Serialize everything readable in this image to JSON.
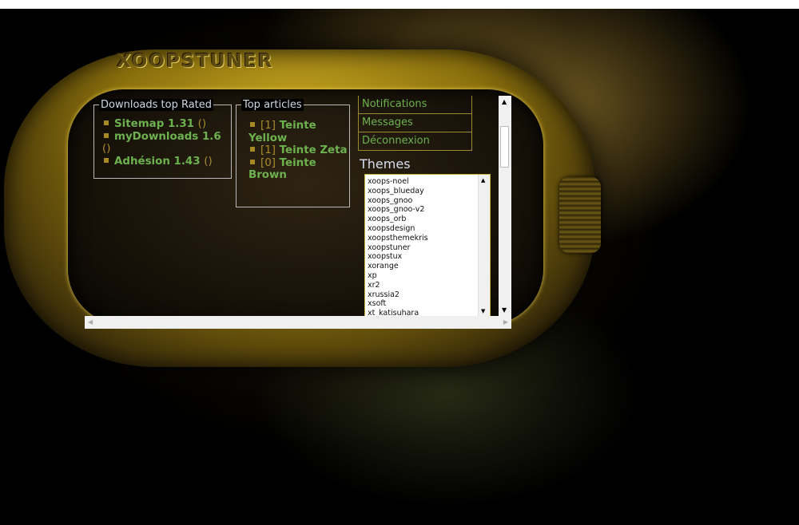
{
  "site": {
    "logo": "XOOPSTUNER"
  },
  "downloads_block": {
    "title": "Downloads top Rated",
    "items": [
      {
        "label": "Sitemap 1.31",
        "paren": "()"
      },
      {
        "label": "myDownloads 1.6",
        "paren": "()"
      },
      {
        "label": "Adhésion 1.43",
        "paren": "()"
      }
    ]
  },
  "articles_block": {
    "title": "Top articles",
    "items": [
      {
        "count": "[1]",
        "label": "Teinte Yellow"
      },
      {
        "count": "[1]",
        "label": "Teinte Zeta"
      },
      {
        "count": "[0]",
        "label": "Teinte Brown"
      }
    ]
  },
  "user_menu": [
    "Notifications",
    "Messages",
    "Déconnexion"
  ],
  "themes_block": {
    "title": "Themes",
    "list": [
      "xoops-noel",
      "xoops_blueday",
      "xoops_gnoo",
      "xoops_gnoo-v2",
      "xoops_orb",
      "xoopsdesign",
      "xoopsthemekris",
      "xoopstuner",
      "xoopstux",
      "xorange",
      "xp",
      "xr2",
      "xrussia2",
      "xsoft",
      "xt_katisuhara"
    ]
  },
  "colors": {
    "link": "#6db24e",
    "accent": "#a98b2c",
    "device_gold": "#c4a320"
  },
  "icons": {
    "up_arrow": "▲",
    "down_arrow": "▼",
    "left_arrow": "◀",
    "right_arrow": "▶",
    "grip": "≡"
  }
}
